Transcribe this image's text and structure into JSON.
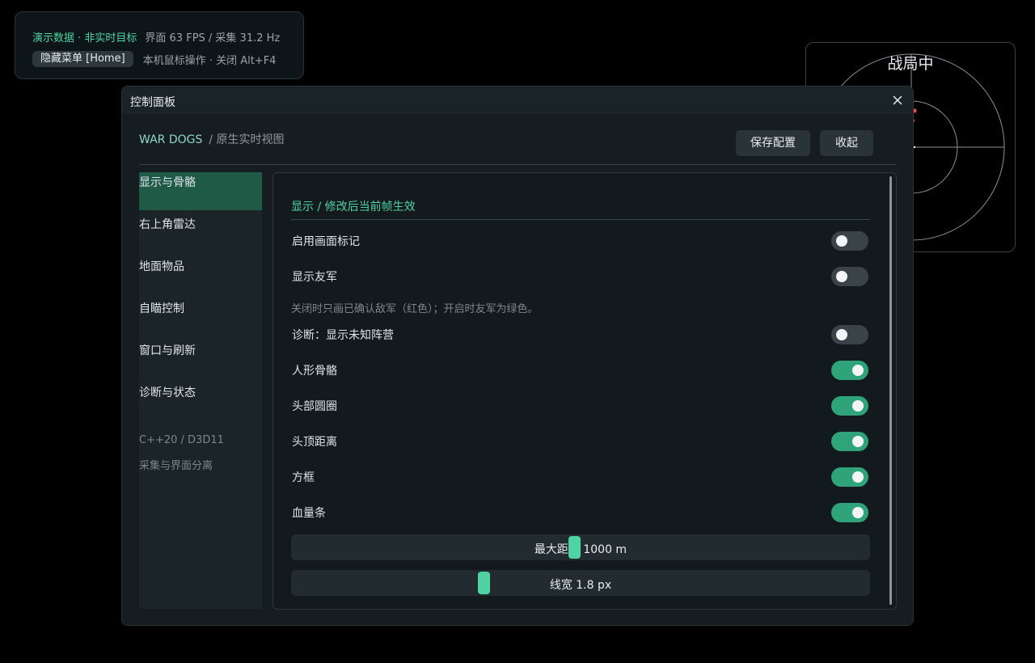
{
  "hud": {
    "mode": "演示数据 · 非实时目标",
    "stats": "界面 63 FPS / 采集 31.2 Hz",
    "hide_menu_label": "隐藏菜单 [Home]",
    "help": "本机鼠标操作 · 关闭 Alt+F4"
  },
  "radar": {
    "status": "战局中"
  },
  "panel": {
    "title": "控制面板",
    "brand": "WAR DOGS",
    "brand_sub": "/ 原生实时视图",
    "save_label": "保存配置",
    "collapse_label": "收起"
  },
  "sidebar": {
    "items": [
      {
        "label": "显示与骨骼",
        "active": true
      },
      {
        "label": "右上角雷达",
        "active": false
      },
      {
        "label": "地面物品",
        "active": false
      },
      {
        "label": "自瞄控制",
        "active": false
      },
      {
        "label": "窗口与刷新",
        "active": false
      },
      {
        "label": "诊断与状态",
        "active": false
      }
    ],
    "footer_line1": "C++20 / D3D11",
    "footer_line2": "采集与界面分离"
  },
  "content": {
    "section_title": "显示 / 修改后当前帧生效",
    "toggles": [
      {
        "label": "启用画面标记",
        "on": false
      },
      {
        "label": "显示友军",
        "on": false
      },
      {
        "label": "诊断：显示未知阵营",
        "on": false
      },
      {
        "label": "人形骨骼",
        "on": true
      },
      {
        "label": "头部圆圈",
        "on": true
      },
      {
        "label": "头顶距离",
        "on": true
      },
      {
        "label": "方框",
        "on": true
      },
      {
        "label": "血量条",
        "on": true
      }
    ],
    "hint": "关闭时只画已确认敌军（红色）；开启时友军为绿色。",
    "sliders": [
      {
        "label": "最大距离 1000 m",
        "fraction": 0.49
      },
      {
        "label": "线宽 1.8 px",
        "fraction": 0.33
      }
    ]
  },
  "colors": {
    "accent": "#4fd3a2",
    "toggle_on": "#2fa47a",
    "toggle_off": "#3a4448",
    "active_nav": "#1f5a47",
    "radar_marker": "#ff4d4d"
  }
}
